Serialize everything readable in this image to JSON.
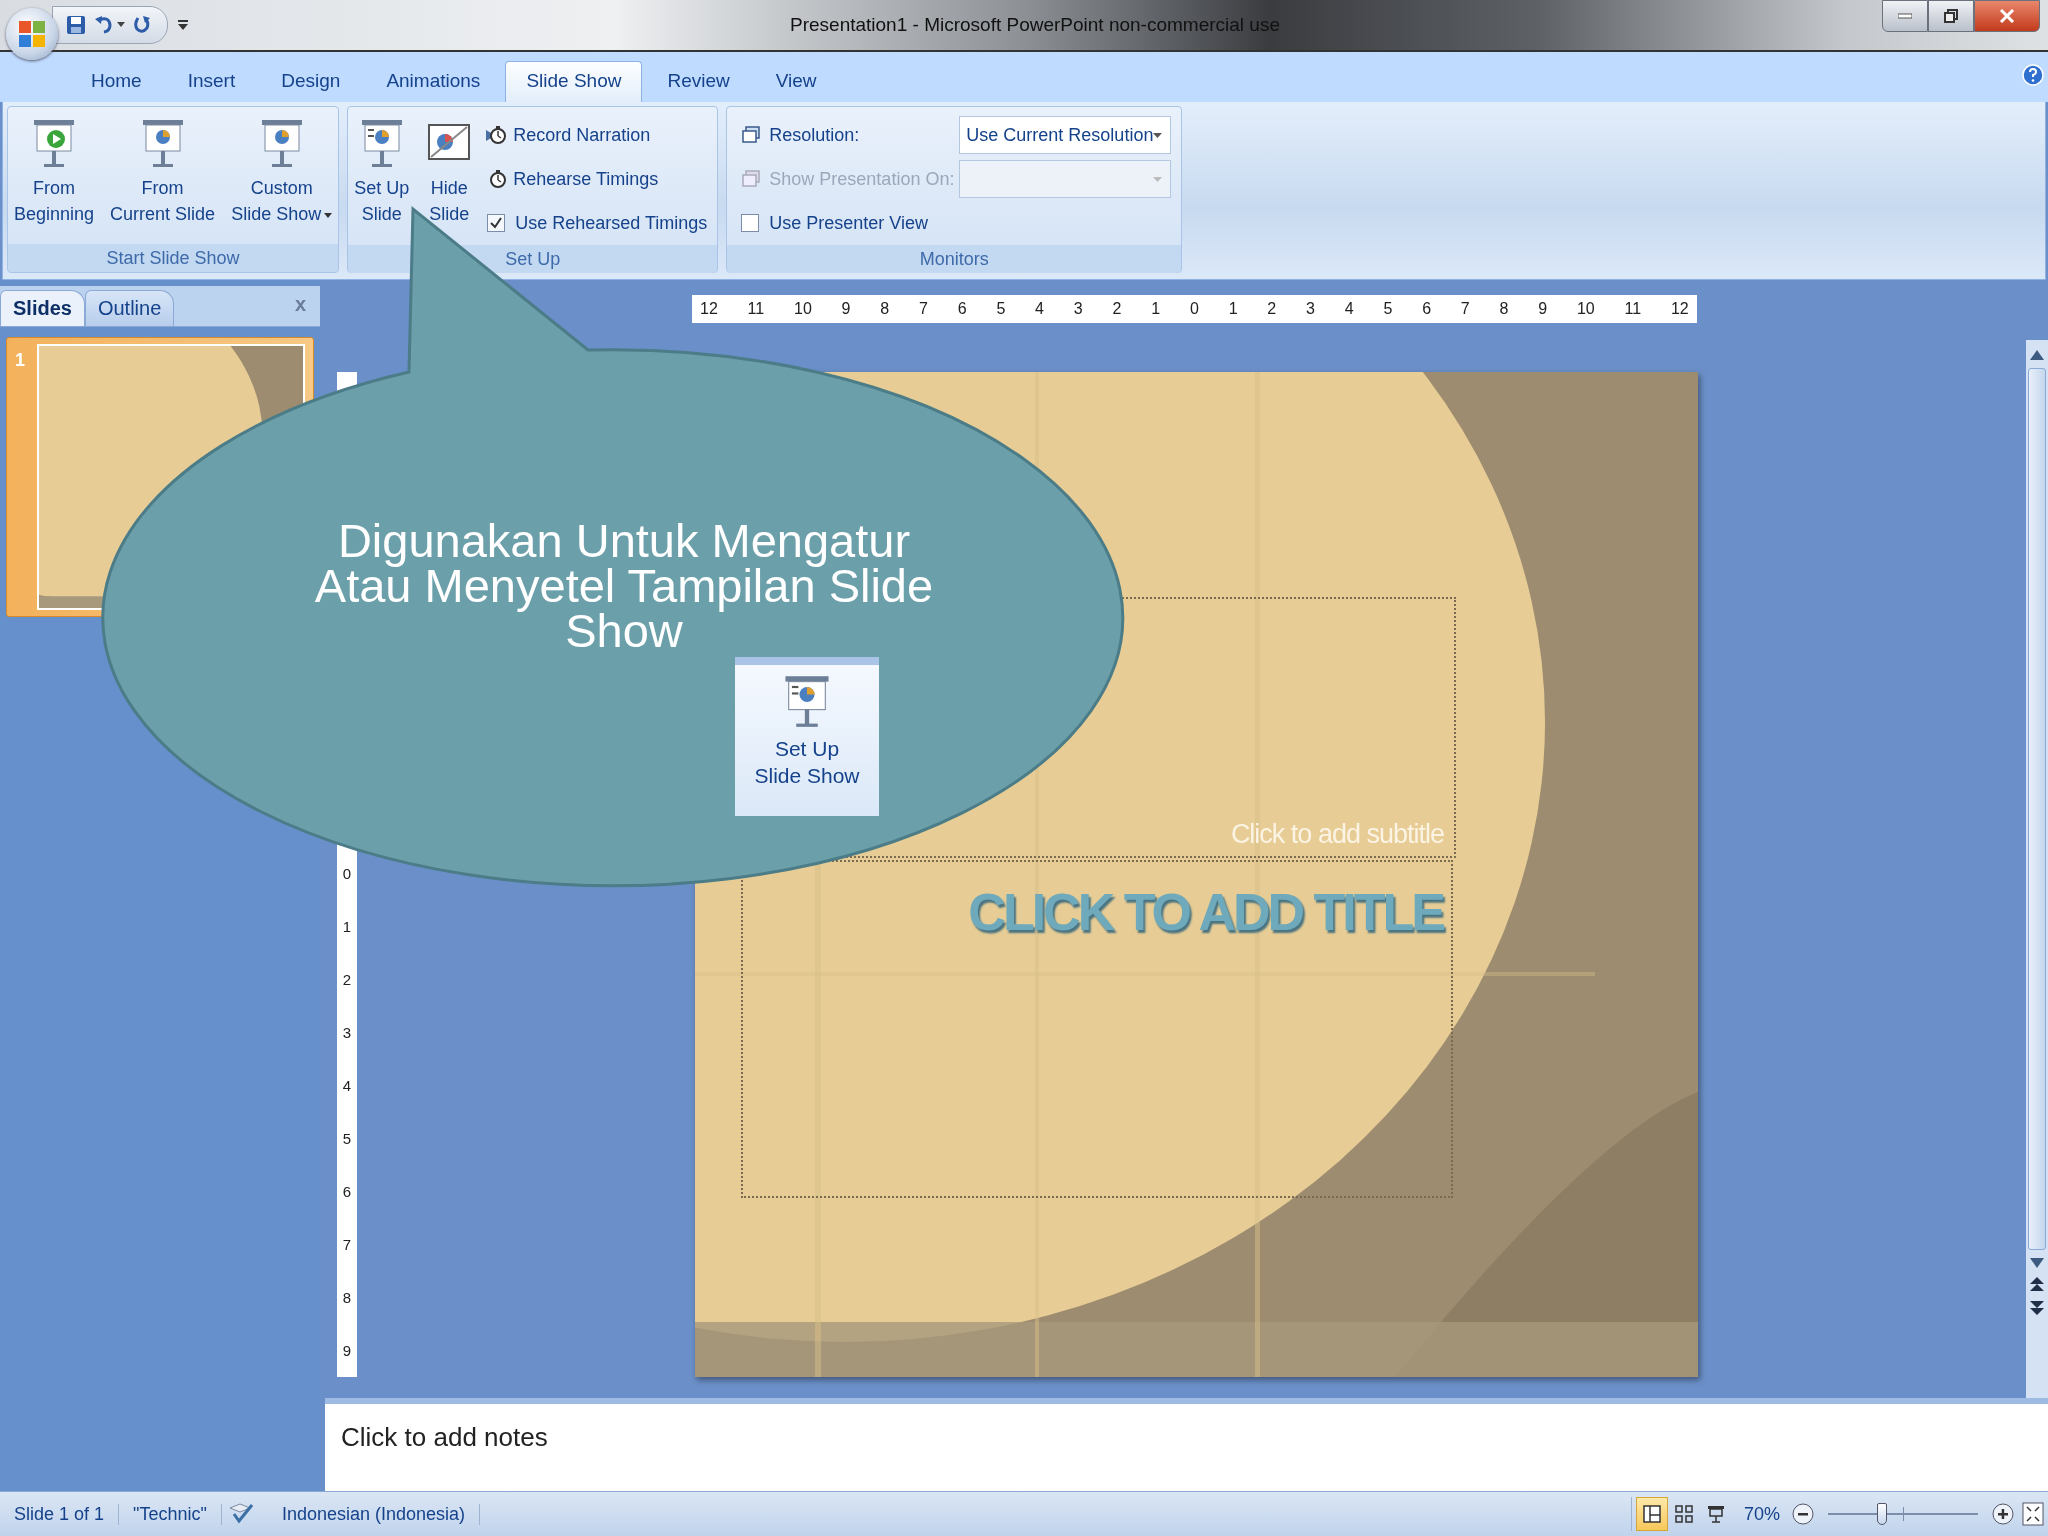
{
  "window": {
    "title": "Presentation1  -  Microsoft PowerPoint non-commercial use"
  },
  "tabs": [
    {
      "label": "Home",
      "selected": false
    },
    {
      "label": "Insert",
      "selected": false
    },
    {
      "label": "Design",
      "selected": false
    },
    {
      "label": "Animations",
      "selected": false
    },
    {
      "label": "Slide Show",
      "selected": true
    },
    {
      "label": "Review",
      "selected": false
    },
    {
      "label": "View",
      "selected": false
    }
  ],
  "ribbon": {
    "groups": [
      {
        "title": "Start Slide Show",
        "buttons": [
          {
            "lines": [
              "From",
              "Beginning"
            ],
            "dropdown": false
          },
          {
            "lines": [
              "From",
              "Current Slide"
            ],
            "dropdown": false
          },
          {
            "lines": [
              "Custom",
              "Slide Show"
            ],
            "dropdown": true
          }
        ]
      },
      {
        "title": "Set Up",
        "buttons": [
          {
            "lines": [
              "Set Up",
              "Slide"
            ],
            "dropdown": false
          },
          {
            "lines": [
              "Hide",
              "Slide"
            ],
            "dropdown": false
          }
        ],
        "rows": [
          {
            "kind": "button",
            "label": "Record Narration"
          },
          {
            "kind": "button",
            "label": "Rehearse Timings"
          },
          {
            "kind": "checkbox",
            "label": "Use Rehearsed Timings",
            "checked": true
          }
        ]
      },
      {
        "title": "Monitors",
        "rows": [
          {
            "kind": "select",
            "label": "Resolution:",
            "value": "Use Current Resolution",
            "disabled": false
          },
          {
            "kind": "select",
            "label": "Show Presentation On:",
            "disabled": true
          },
          {
            "kind": "checkbox",
            "label": "Use Presenter View",
            "checked": false
          }
        ]
      }
    ]
  },
  "slides_pane": {
    "tabs": [
      {
        "label": "Slides",
        "selected": true
      },
      {
        "label": "Outline",
        "selected": false
      }
    ],
    "close": "x",
    "thumbnails": [
      {
        "number": "1",
        "selected": true
      }
    ]
  },
  "horizontal_ruler": [
    "12",
    "11",
    "10",
    "9",
    "8",
    "7",
    "6",
    "5",
    "4",
    "3",
    "2",
    "1",
    "0",
    "1",
    "2",
    "3",
    "4",
    "5",
    "6",
    "7",
    "8",
    "9",
    "10",
    "11",
    "12"
  ],
  "vertical_ruler": [
    "0",
    "1",
    "2",
    "3",
    "4",
    "5",
    "6",
    "7",
    "8",
    "9"
  ],
  "slide": {
    "subtitle_placeholder": "Click to add subtitle",
    "title_placeholder": "CLICK TO ADD TITLE"
  },
  "notes": {
    "placeholder": "Click to add notes"
  },
  "status_bar": {
    "items": [
      "Slide 1 of 1",
      "\"Technic\"",
      "Indonesian (Indonesia)"
    ],
    "views": [
      {
        "selected": true
      },
      {
        "selected": false
      },
      {
        "selected": false
      }
    ],
    "zoom": {
      "reading": "70%",
      "level": 0.36
    }
  },
  "callout": {
    "lines": [
      "Digunakan Untuk Mengatur",
      "Atau Menyetel Tampilan Slide",
      "Show"
    ],
    "inset_button": [
      "Set Up",
      "Slide Show"
    ]
  }
}
